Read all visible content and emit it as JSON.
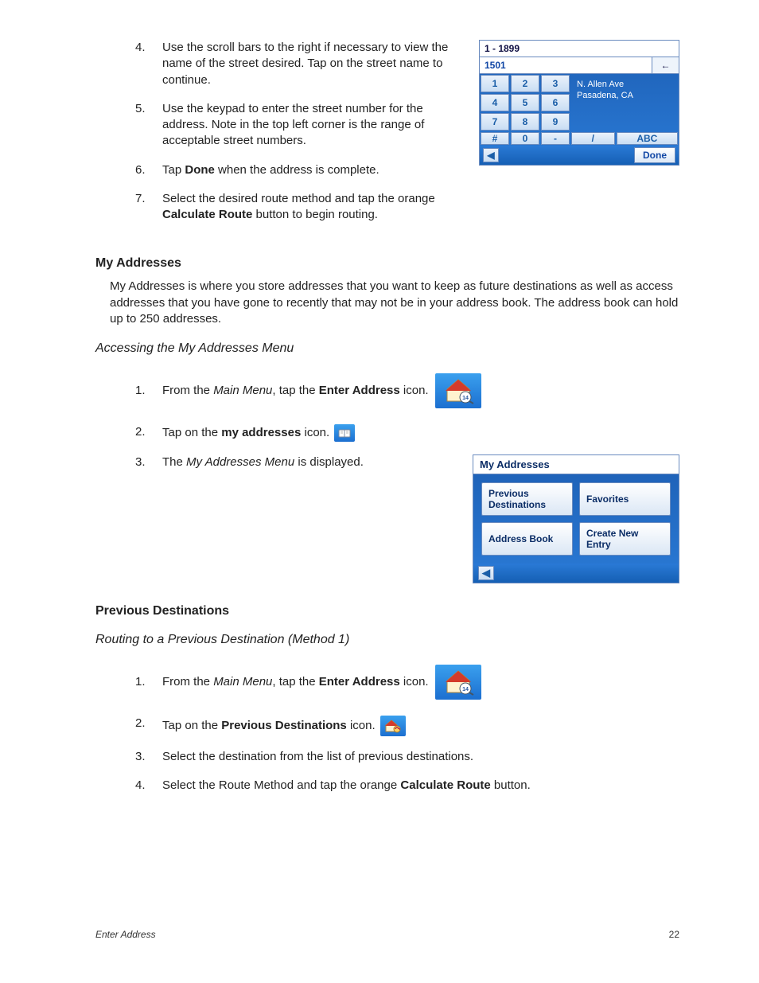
{
  "top_steps": [
    {
      "n": "4.",
      "text": "Use the scroll bars to the right if necessary to view the name of the street desired.  Tap on the street name to continue."
    },
    {
      "n": "5.",
      "text": "Use the keypad to enter the street number for the address.  Note in the top left corner is the range of acceptable street numbers."
    },
    {
      "n": "6.",
      "text_pre": "Tap ",
      "bold": "Done",
      "text_post": " when the address is complete."
    },
    {
      "n": "7.",
      "text_pre": "Select the desired route method and tap the orange ",
      "bold": "Calculate Route",
      "text_post": " button to begin routing."
    }
  ],
  "keypad": {
    "range": "1 - 1899",
    "value": "1501",
    "backspace": "←",
    "keys_row1": [
      "1",
      "2",
      "3"
    ],
    "keys_row2": [
      "4",
      "5",
      "6"
    ],
    "keys_row3": [
      "7",
      "8",
      "9"
    ],
    "keys_row4": [
      "#",
      "0",
      "-",
      "/",
      "ABC"
    ],
    "side_line1": "N. Allen Ave",
    "side_line2": "Pasadena, CA",
    "back_arrow": "◀",
    "done": "Done"
  },
  "sec_my_addresses_title": "My Addresses",
  "sec_my_addresses_para": "My Addresses is where you store addresses that you want to keep as future destinations as well as access addresses that you have gone to recently that may not be in your address book.  The address book can hold up to 250 addresses.",
  "sub_accessing": "Accessing the My Addresses Menu",
  "accessing_steps": {
    "s1_n": "1.",
    "s1_pre": "From the ",
    "s1_it": "Main Menu",
    "s1_mid": ", tap the ",
    "s1_b": "Enter Address",
    "s1_post": " icon.",
    "s2_n": "2.",
    "s2_pre": "Tap on the ",
    "s2_b": "my addresses",
    "s2_post": " icon.",
    "s3_n": "3.",
    "s3_pre": "The ",
    "s3_it": "My Addresses Menu",
    "s3_post": " is displayed."
  },
  "menu_fig": {
    "title": "My Addresses",
    "btn1": "Previous Destinations",
    "btn2": "Favorites",
    "btn3": "Address Book",
    "btn4": "Create New Entry",
    "back": "◀"
  },
  "sec_prev_dest_title": "Previous Destinations",
  "sub_routing": "Routing to a Previous Destination (Method 1)",
  "routing_steps": {
    "s1_n": "1.",
    "s1_pre": "From the ",
    "s1_it": "Main Menu",
    "s1_mid": ", tap the ",
    "s1_b": "Enter Address",
    "s1_post": " icon.",
    "s2_n": "2.",
    "s2_pre": "Tap on the ",
    "s2_b": "Previous Destinations",
    "s2_post": " icon.",
    "s3_n": "3.",
    "s3_txt": "Select the destination from the list of previous destinations.",
    "s4_n": "4.",
    "s4_pre": "Select the Route Method and tap the orange ",
    "s4_b": "Calculate Route",
    "s4_post": " button."
  },
  "footer": {
    "left": "Enter Address",
    "right": "22"
  }
}
